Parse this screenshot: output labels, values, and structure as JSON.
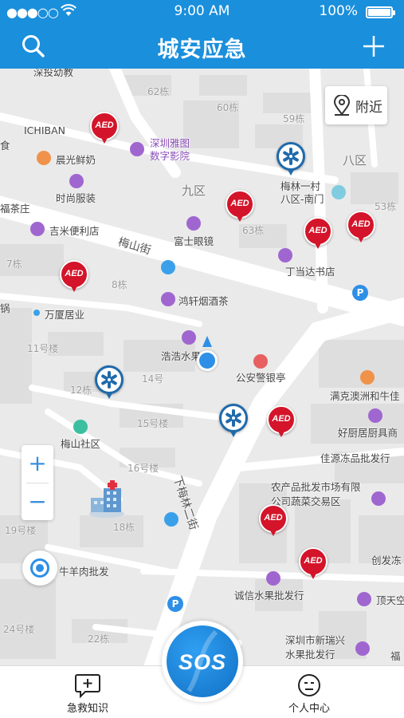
{
  "status_bar": {
    "signal": "●●●○○",
    "time": "9:00 AM",
    "battery": "100%"
  },
  "header": {
    "title": "城安应急"
  },
  "map": {
    "nearby_label": "附近",
    "zoom_in": "+",
    "zoom_out": "−",
    "aed_text": "AED",
    "labels": {
      "shenbao_kindergarten": "深投幼教",
      "building_62": "62栋",
      "building_60": "60栋",
      "building_59": "59栋",
      "ichiban": "ICHIBAN",
      "shi": "食",
      "chenguang_milk": "晨光鲜奶",
      "yatu_cinema": "深圳雅图\n数字影院",
      "jiuqu": "九区",
      "baqu": "八区",
      "meilin_gate": "梅林一村\n八区-南门",
      "shishang_fuzhuang": "时尚服装",
      "fuchazhuang": "福茶庄",
      "building_63": "63栋",
      "building_53": "53栋",
      "jixiang_store": "吉米便利店",
      "fushi_glasses": "富士眼镜",
      "meishan_street": "梅山街",
      "dingdangda_bookstore": "丁当达书店",
      "building_7": "7栋",
      "building_8": "8栋",
      "wanxia_residence": "万厦居业",
      "guo": "锅",
      "hongxuan_tobacco": "鸿轩烟酒茶",
      "building_11": "11号楼",
      "haohao_fruit": "浩浩水果",
      "building_14": "14号",
      "building_12": "12栋",
      "police_booth": "公安警银亭",
      "manke_aozhou": "满克澳洲和牛佳",
      "haochu_kitchen": "好厨居厨具商",
      "building_15": "15号楼",
      "meishan_community": "梅山社区",
      "building_16": "16号楼",
      "jiayuan_frozen": "佳源冻品批发行",
      "xia_meilin_street": "下梅林二街",
      "agri_market": "农产品批发市场有限\n公司蔬菜交易区",
      "building_19": "19号楼",
      "building_18": "18栋",
      "niuyang_meat": "牛羊肉批发",
      "chuangfa_dong": "创发冻",
      "chengxin_fruit": "诚信水果批发行",
      "dingtian": "顶天空",
      "building_24": "24号楼",
      "building_22": "22栋",
      "xinruixing_fruit": "深圳市新瑞兴\n水果批发行",
      "fu": "福"
    }
  },
  "tabs": [
    {
      "label": "急救知识"
    },
    {
      "label": "个人中心"
    }
  ],
  "sos": {
    "label": "SOS"
  },
  "colors": {
    "primary": "#1a8fdc",
    "aed_red": "#d4142a",
    "rescue_blue": "#1f6aab"
  }
}
